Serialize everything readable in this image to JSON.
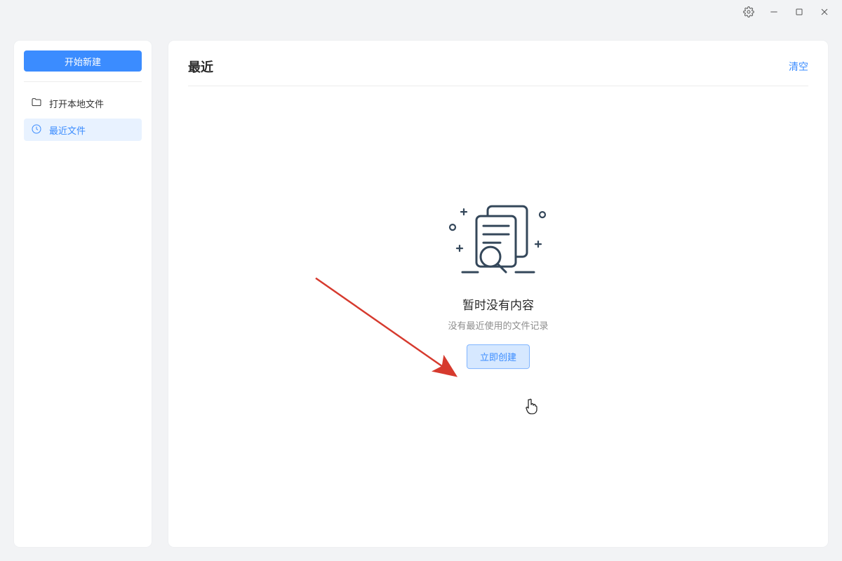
{
  "sidebar": {
    "start_new_label": "开始新建",
    "items": [
      {
        "label": "打开本地文件"
      },
      {
        "label": "最近文件"
      }
    ]
  },
  "content": {
    "header_title": "最近",
    "clear_label": "清空",
    "empty_title": "暂时没有内容",
    "empty_subtitle": "没有最近使用的文件记录",
    "create_label": "立即创建"
  }
}
